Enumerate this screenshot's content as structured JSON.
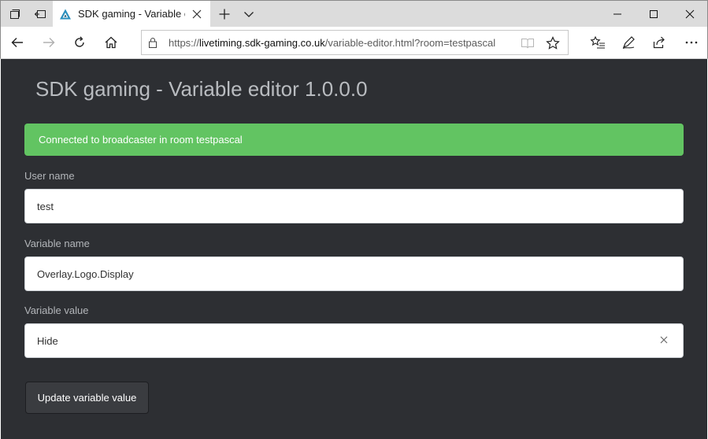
{
  "browser": {
    "tab": {
      "title": "SDK gaming - Variable editor 1.0.0.0"
    },
    "address": {
      "scheme": "https://",
      "host": "livetiming.sdk-gaming.co.uk",
      "path": "/variable-editor.html?room=testpascal"
    },
    "icons": {
      "tab_actions": "tab-actions-icon",
      "set_tabs_aside": "set-tabs-aside-icon",
      "favicon": "sdk-gaming-logo",
      "new_tab": "plus-icon",
      "tab_list": "chevron-down-icon",
      "minimize": "minimize-icon",
      "maximize": "maximize-icon",
      "close": "close-icon",
      "back": "back-arrow-icon",
      "forward": "forward-arrow-icon",
      "refresh": "refresh-icon",
      "home": "home-icon",
      "lock": "lock-icon",
      "reading_view": "book-icon",
      "favorite": "star-icon",
      "favorites_list": "favorites-list-icon",
      "web_note": "pen-icon",
      "share": "share-icon",
      "more": "more-icon"
    }
  },
  "page": {
    "title": "SDK gaming - Variable editor 1.0.0.0",
    "alert": "Connected to broadcaster in room testpascal",
    "fields": {
      "user_name": {
        "label": "User name",
        "value": "test"
      },
      "variable_name": {
        "label": "Variable name",
        "value": "Overlay.Logo.Display"
      },
      "variable_value": {
        "label": "Variable value",
        "value": "Hide"
      }
    },
    "update_button": "Update variable value"
  },
  "colors": {
    "page_background": "#2d2f33",
    "alert_success": "#62c462",
    "button_background": "#3a3c40",
    "favicon_blue": "#2a8fbd"
  }
}
